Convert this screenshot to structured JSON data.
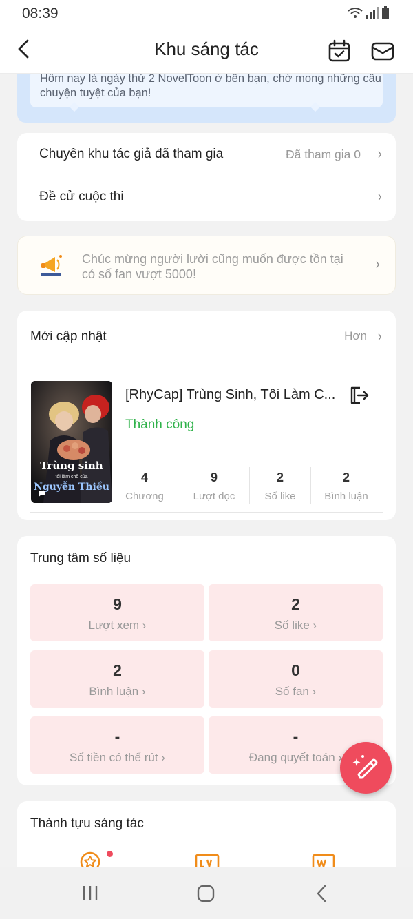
{
  "status_bar": {
    "time": "08:39"
  },
  "header": {
    "title": "Khu sáng tác",
    "back_icon": "back-arrow-icon",
    "calendar_icon": "calendar-check-icon",
    "mail_icon": "mail-icon"
  },
  "banner": {
    "message": "Hôm nay là ngày thứ 2 NovelToon ở bên bạn, chờ mong những câu chuyện tuyệt của bạn!"
  },
  "menu": {
    "author_zone_label": "Chuyên khu tác giả đã tham gia",
    "author_zone_value": "Đã tham gia 0",
    "contest_label": "Đề cử cuộc thi"
  },
  "notice": {
    "text": "Chúc mừng người lười cũng muốn được tồn tại có số fan vượt 5000!",
    "icon": "megaphone-icon"
  },
  "recent": {
    "title": "Mới cập nhật",
    "more": "Hơn",
    "book": {
      "title": "[RhyCap] Trùng Sinh, Tôi Làm C...",
      "status": "Thành công",
      "cover_title": "Trùng sinh",
      "cover_subtitle": "tôi làm chồ của",
      "cover_name": "Nguyễn Thiều",
      "stats": [
        {
          "value": "4",
          "label": "Chương"
        },
        {
          "value": "9",
          "label": "Lượt đọc"
        },
        {
          "value": "2",
          "label": "Số like"
        },
        {
          "value": "2",
          "label": "Bình luận"
        }
      ]
    }
  },
  "data_center": {
    "title": "Trung tâm số liệu",
    "tiles": [
      {
        "value": "9",
        "label": "Lượt xem"
      },
      {
        "value": "2",
        "label": "Số like"
      },
      {
        "value": "2",
        "label": "Bình luận"
      },
      {
        "value": "0",
        "label": "Số fan"
      },
      {
        "value": "-",
        "label": "Số tiền có thể rút"
      },
      {
        "value": "-",
        "label": "Đang quyết toán"
      }
    ]
  },
  "achievements": {
    "title": "Thành tựu sáng tác"
  },
  "colors": {
    "accent": "#ef4b5d",
    "success": "#2fb24a",
    "tile_bg": "#fde9ea",
    "banner_bg": "#d5e6fb",
    "achievement_orange": "#f08c1a"
  }
}
